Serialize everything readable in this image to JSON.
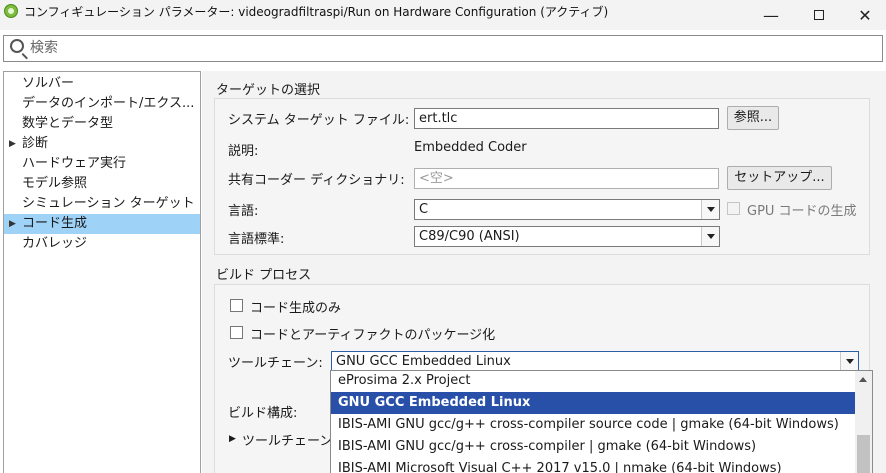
{
  "window": {
    "title": "コンフィギュレーション パラメーター: videogradfiltraspi/Run on Hardware Configuration (アクティブ)",
    "controls": {
      "minimize": "—",
      "close": "✕"
    }
  },
  "search": {
    "placeholder": "検索"
  },
  "nav": {
    "items": [
      {
        "label": "ソルバー",
        "arrow": ""
      },
      {
        "label": "データのインポート/エクス...",
        "arrow": ""
      },
      {
        "label": "数学とデータ型",
        "arrow": ""
      },
      {
        "label": "診断",
        "arrow": "▶"
      },
      {
        "label": "ハードウェア実行",
        "arrow": ""
      },
      {
        "label": "モデル参照",
        "arrow": ""
      },
      {
        "label": "シミュレーション ターゲット",
        "arrow": ""
      },
      {
        "label": "コード生成",
        "arrow": "▶"
      },
      {
        "label": "カバレッジ",
        "arrow": ""
      }
    ],
    "selected_index": 7
  },
  "target_section": {
    "title": "ターゲットの選択",
    "system_target_label": "システム ターゲット ファイル:",
    "system_target_value": "ert.tlc",
    "browse_button": "参照...",
    "description_label": "説明:",
    "description_value": "Embedded Coder",
    "shared_dict_label": "共有コーダー ディクショナリ:",
    "shared_dict_placeholder": "<空>",
    "setup_button": "セットアップ...",
    "language_label": "言語:",
    "language_value": "C",
    "gpu_label": "GPU コードの生成",
    "language_standard_label": "言語標準:",
    "language_standard_value": "C89/C90 (ANSI)"
  },
  "build_section": {
    "title": "ビルド プロセス",
    "generate_only_label": "コード生成のみ",
    "package_label": "コードとアーティファクトのパッケージ化",
    "toolchain_label": "ツールチェーン:",
    "toolchain_value": "GNU GCC Embedded Linux",
    "build_config_label": "ビルド構成:",
    "toolchain_details_label": "ツールチェーン",
    "toolchain_details_arrow": "▶"
  },
  "toolchain_dropdown": {
    "options": [
      "eProsima 2.x Project",
      "GNU GCC Embedded Linux",
      "IBIS-AMI GNU gcc/g++ cross-compiler source code | gmake (64-bit Windows)",
      "IBIS-AMI GNU gcc/g++ cross-compiler | gmake (64-bit Windows)",
      "IBIS-AMI Microsoft Visual C++ 2017 v15.0 | nmake (64-bit Windows)"
    ],
    "selected_index": 1
  },
  "colors": {
    "nav_selected": "#9fd2f7",
    "list_selected": "#2850a8",
    "panel_bg": "#f3f3f3"
  }
}
